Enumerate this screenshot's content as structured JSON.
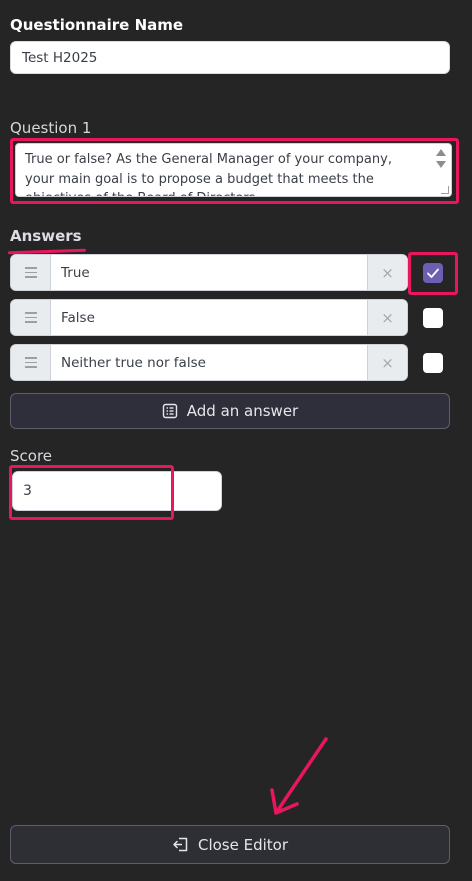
{
  "questionnaire": {
    "name_label": "Questionnaire Name",
    "name_value": "Test H2025"
  },
  "question": {
    "label": "Question 1",
    "text": "True or false? As the General Manager of your company, your main goal is to propose a budget that meets the objectives of the Board of Directors."
  },
  "answers": {
    "label": "Answers",
    "items": [
      {
        "label": "True",
        "checked": true
      },
      {
        "label": "False",
        "checked": false
      },
      {
        "label": "Neither true nor false",
        "checked": false
      }
    ],
    "remove_symbol": "×",
    "add_label": "Add an answer"
  },
  "score": {
    "label": "Score",
    "value": "3"
  },
  "footer": {
    "close_label": "Close Editor"
  },
  "colors": {
    "highlight": "#e8175d",
    "checkbox_checked": "#6a5fb0",
    "background": "#252525"
  }
}
